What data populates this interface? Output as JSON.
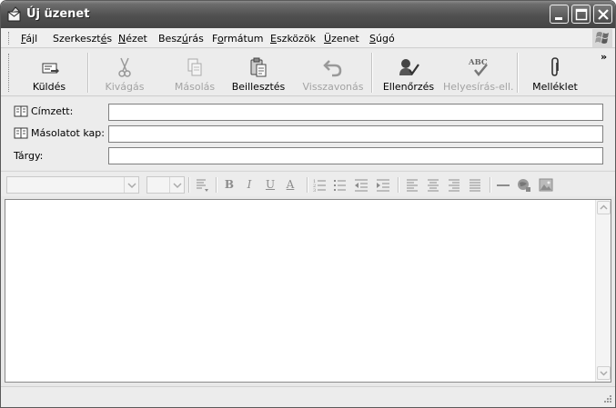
{
  "window": {
    "title": "Új üzenet"
  },
  "menu": [
    {
      "pre": "",
      "u": "F",
      "post": "ájl"
    },
    {
      "pre": "Szerkeszt",
      "u": "é",
      "post": "s"
    },
    {
      "pre": "",
      "u": "N",
      "post": "ézet"
    },
    {
      "pre": "Besz",
      "u": "ú",
      "post": "rás"
    },
    {
      "pre": "F",
      "u": "o",
      "post": "rmátum"
    },
    {
      "pre": "",
      "u": "E",
      "post": "szközök"
    },
    {
      "pre": "",
      "u": "Ü",
      "post": "zenet"
    },
    {
      "pre": "",
      "u": "S",
      "post": "úgó"
    }
  ],
  "toolbar": {
    "send": "Küldés",
    "cut": "Kivágás",
    "copy": "Másolás",
    "paste": "Beillesztés",
    "undo": "Visszavonás",
    "check": "Ellenőrzés",
    "spelling": "Helyesírás-ell...",
    "attach": "Melléklet",
    "more": "»"
  },
  "fields": {
    "to_label": "Címzett:",
    "to_value": "",
    "cc_label": "Másolatot kap:",
    "cc_value": "",
    "subject_label": "Tárgy:",
    "subject_value": ""
  },
  "format": {
    "bold": "B",
    "italic": "I",
    "underline": "U",
    "fontcolor": "A"
  },
  "body": {
    "text": ""
  }
}
